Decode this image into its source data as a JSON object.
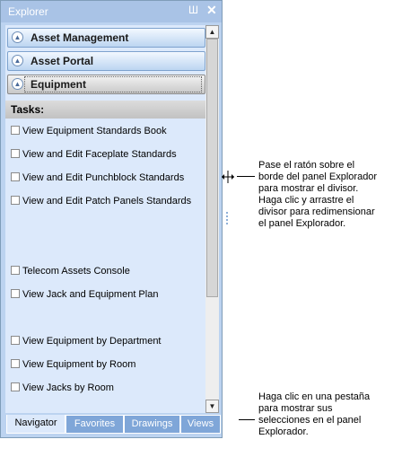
{
  "explorer": {
    "title": "Explorer",
    "pin_glyph": "Ш",
    "close_glyph": "✕"
  },
  "groups": [
    {
      "label": "Asset Management",
      "icon": "chevron-up-icon"
    },
    {
      "label": "Asset Portal",
      "icon": "chevron-up-icon"
    },
    {
      "label": "Equipment",
      "icon": "chevron-up-icon"
    }
  ],
  "tasks_header": "Tasks:",
  "tasks": [
    "View Equipment Standards Book",
    "View and Edit Faceplate Standards",
    "View and Edit Punchblock Standards",
    "View and Edit Patch Panels Standards",
    "Telecom Assets Console",
    "View Jack and Equipment Plan",
    "View Equipment by Department",
    "View Equipment by Room",
    "View Jacks by Room"
  ],
  "tabs": [
    "Navigator",
    "Favorites",
    "Drawings",
    "Views"
  ],
  "callouts": {
    "splitter": "Pase el ratón sobre el\nborde del panel Explorador\npara mostrar el divisor.\nHaga clic y arrastre el\ndivisor para redimensionar\nel panel Explorador.",
    "tabs": "Haga clic en una pestaña\npara mostrar sus\nselecciones en el panel\nExplorador."
  },
  "colors": {
    "panel_bg": "#bcd3f0",
    "content_bg": "#dce9fb",
    "tab_bg": "#7fa6d8"
  }
}
